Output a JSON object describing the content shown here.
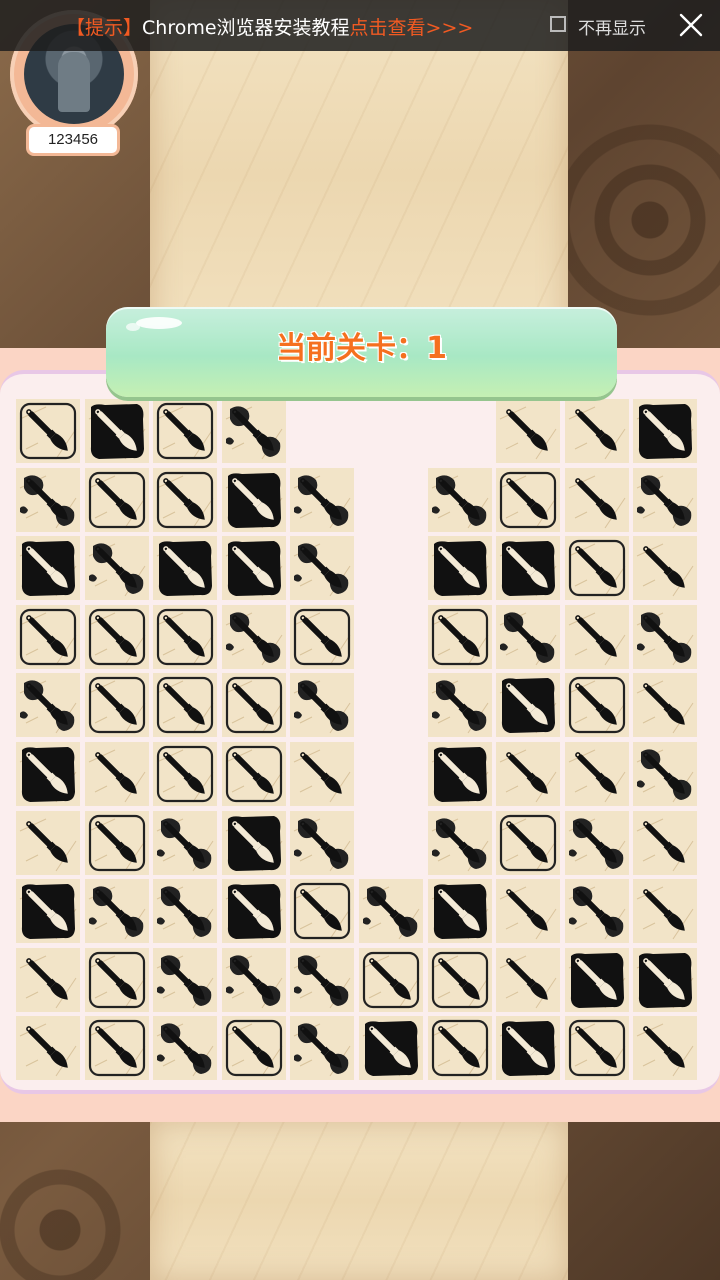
{
  "notice": {
    "tag": "【提示】",
    "text": "Chrome浏览器安装教程",
    "link": "点击查看>>>",
    "dont_show_label": "不再显示",
    "dont_show_checked": false,
    "close_icon": "close-icon"
  },
  "player": {
    "score": "123456",
    "avatar_icon": "avatar"
  },
  "level": {
    "label": "当前关卡：",
    "number": "1"
  },
  "board": {
    "columns": 10,
    "rows": 10,
    "tile_kinds": {
      "A": "brush-in-frame-tile",
      "B": "brush-on-black-block-tile",
      "C": "brush-ink-splash-tile",
      "D": "plain-brush-tile"
    },
    "grid": [
      [
        "A",
        "B",
        "A",
        "C",
        null,
        null,
        null,
        "D",
        "D",
        "B"
      ],
      [
        "C",
        "A",
        "A",
        "B",
        "C",
        null,
        "C",
        "A",
        "D",
        "C"
      ],
      [
        "B",
        "C",
        "B",
        "B",
        "C",
        null,
        "B",
        "B",
        "A",
        "D"
      ],
      [
        "A",
        "A",
        "A",
        "C",
        "A",
        null,
        "A",
        "C",
        "D",
        "C"
      ],
      [
        "C",
        "A",
        "A",
        "A",
        "C",
        null,
        "C",
        "B",
        "A",
        "D"
      ],
      [
        "B",
        "D",
        "A",
        "A",
        "D",
        null,
        "B",
        "D",
        "D",
        "C"
      ],
      [
        "D",
        "A",
        "C",
        "B",
        "C",
        null,
        "C",
        "A",
        "C",
        "D"
      ],
      [
        "B",
        "C",
        "C",
        "B",
        "A",
        "C",
        "B",
        "D",
        "C",
        "D"
      ],
      [
        "D",
        "A",
        "C",
        "C",
        "C",
        "A",
        "A",
        "D",
        "B",
        "B"
      ],
      [
        "D",
        "A",
        "C",
        "A",
        "C",
        "B",
        "A",
        "B",
        "A",
        "D"
      ]
    ]
  }
}
